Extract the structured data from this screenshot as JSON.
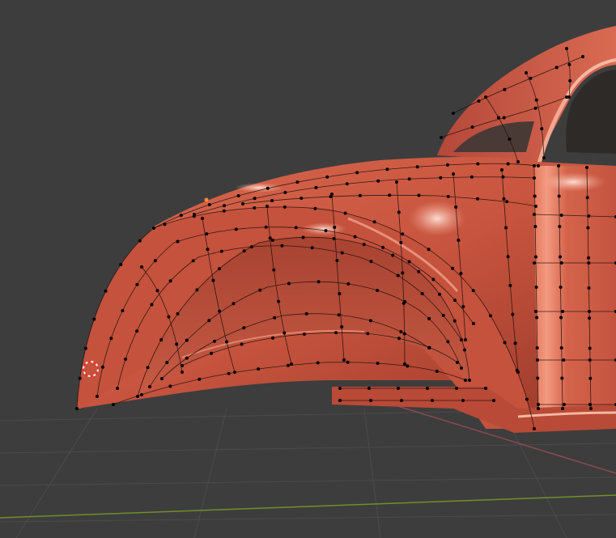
{
  "viewport": {
    "background_color": "#3d3d3d",
    "grid_color": "#4b4b4b",
    "x_axis_color": "#8a4a52",
    "y_axis_color": "#6f8f2c",
    "mode": "edit-mode",
    "shading": "solid-matcap"
  },
  "model": {
    "object": "car-body-front-fender",
    "surface_color": "#c8553f",
    "highlight_color": "#f4b29e",
    "shadow_color": "#7a2a1f",
    "wire_color": "#1a0d0a",
    "vertex_color": "#000000",
    "active_vertex_color": "#ff8a3c"
  },
  "cursor_3d": {
    "icon": "3d-cursor-icon",
    "ring_colors": [
      "#ff2a2a",
      "#ffffff"
    ]
  }
}
